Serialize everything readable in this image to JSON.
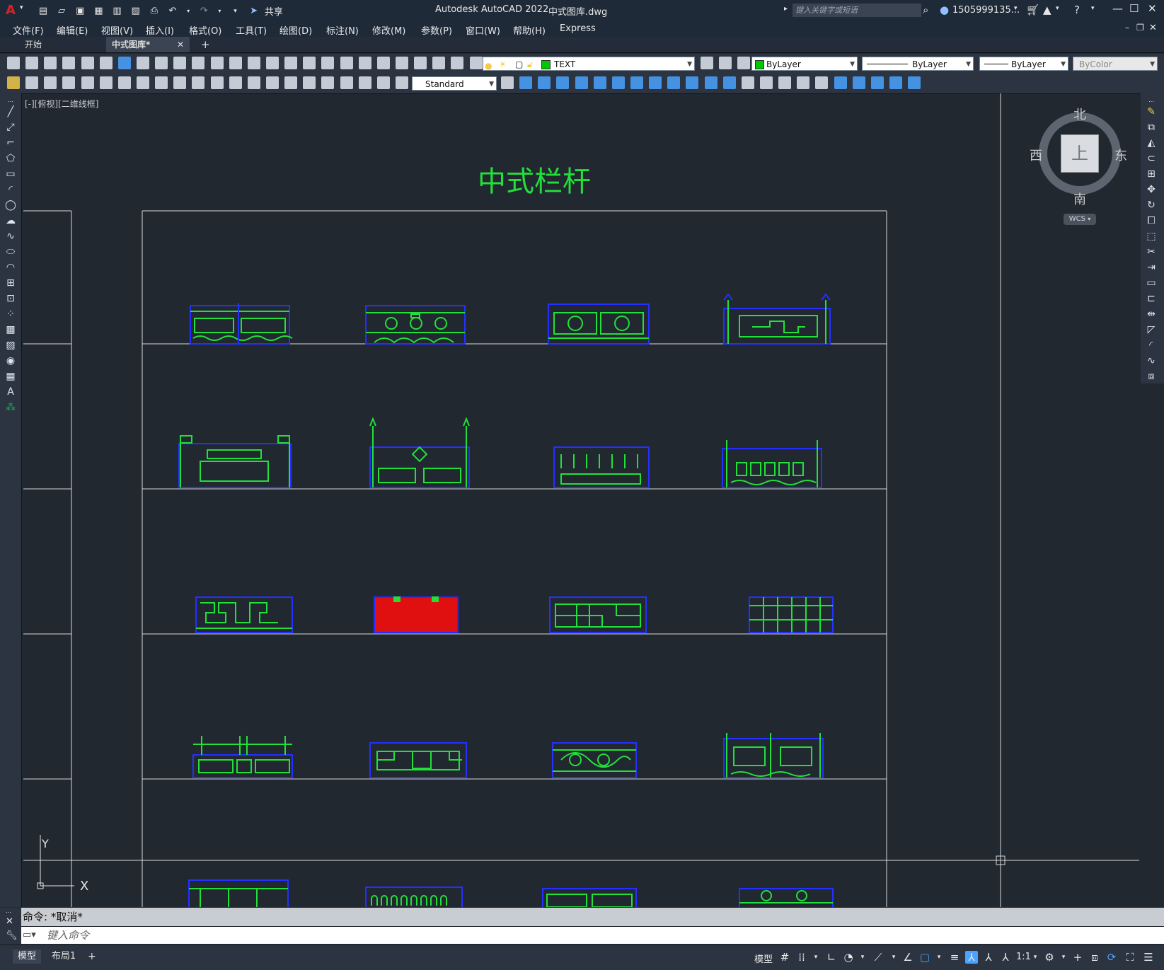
{
  "titlebar": {
    "app_title": "Autodesk AutoCAD 2022",
    "file_title": "中式图库.dwg",
    "share_label": "共享",
    "search_placeholder": "键入关键字或短语",
    "user_name": "1505999135...",
    "app_letter": "A"
  },
  "menu": {
    "items": [
      "文件(F)",
      "编辑(E)",
      "视图(V)",
      "插入(I)",
      "格式(O)",
      "工具(T)",
      "绘图(D)",
      "标注(N)",
      "修改(M)",
      "参数(P)",
      "窗口(W)",
      "帮助(H)",
      "Express"
    ]
  },
  "tabs": {
    "start": "开始",
    "active": "中式图库*",
    "close": "✕",
    "add": "+"
  },
  "toolbar": {
    "layer_combo": "TEXT",
    "color_combo": "ByLayer",
    "linetype_combo": "ByLayer",
    "lineweight_combo": "ByLayer",
    "plotstyle_combo": "ByColor",
    "textstyle_combo": "Standard"
  },
  "viewport": {
    "label": "[-][俯视][二维线框]",
    "drawing_title": "中式栏杆",
    "viewcube": {
      "north": "北",
      "south": "南",
      "east": "东",
      "west": "西",
      "face": "上",
      "wcs": "WCS"
    },
    "ucs": {
      "y": "Y",
      "x": "X"
    }
  },
  "command": {
    "history": "命令: *取消*",
    "placeholder": "键入命令"
  },
  "status": {
    "model_tab": "模型",
    "layout_tab": "布局1",
    "add_tab": "+",
    "model_button": "模型",
    "scale": "1:1"
  },
  "colors": {
    "background": "#212830",
    "drawing_green": "#22e03a",
    "drawing_blue": "#2430ff",
    "drawing_red": "#e01010",
    "frame_line": "#e6e6e6"
  }
}
